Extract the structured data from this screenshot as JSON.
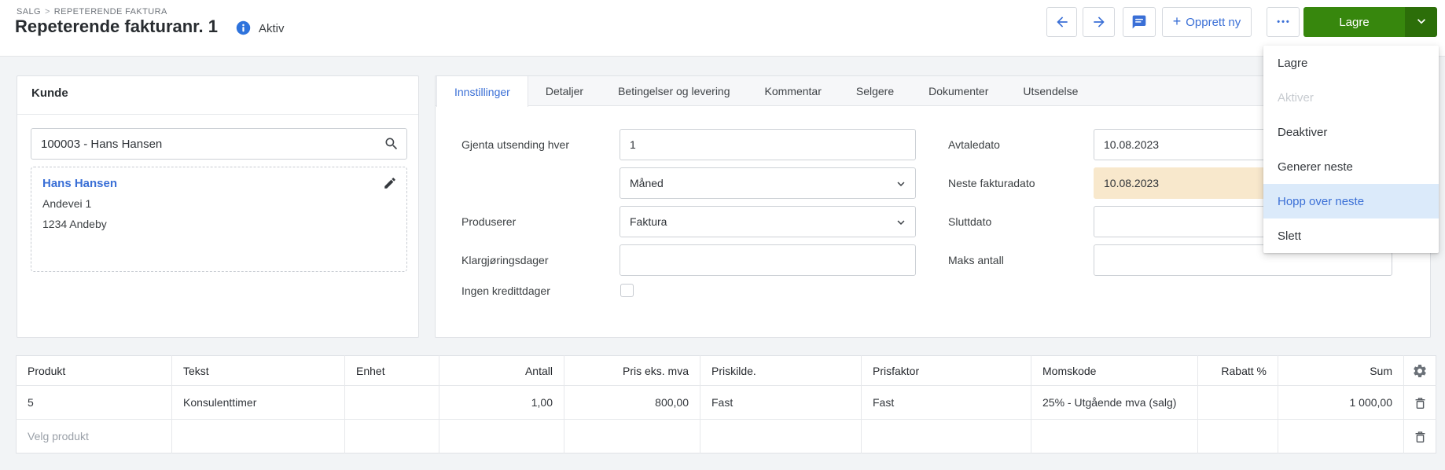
{
  "colors": {
    "accent_blue": "#3a6fd6",
    "save_green": "#37870d",
    "save_green_dark": "#2c6e09",
    "next_date_highlight_bg": "#f8e8cc",
    "menu_highlight_bg": "#dbeafa",
    "status_icon_blue": "#2e73dc"
  },
  "breadcrumb": {
    "items": [
      "SALG",
      "REPETERENDE FAKTURA"
    ],
    "separator": ">"
  },
  "header": {
    "title": "Repeterende fakturanr. 1",
    "status": "Aktiv"
  },
  "toolbar": {
    "back_icon": "arrow-left",
    "forward_icon": "arrow-right",
    "comment_icon": "chat-bubble",
    "opprett_plus": "+",
    "opprett_label": "Opprett ny",
    "dots": "•••",
    "lagre_label": "Lagre"
  },
  "menu": {
    "items": [
      {
        "label": "Lagre",
        "state": "normal"
      },
      {
        "label": "Aktiver",
        "state": "disabled"
      },
      {
        "label": "Deaktiver",
        "state": "normal"
      },
      {
        "label": "Generer neste",
        "state": "normal"
      },
      {
        "label": "Hopp over neste",
        "state": "highlighted"
      },
      {
        "label": "Slett",
        "state": "normal"
      }
    ]
  },
  "customer": {
    "panel_title": "Kunde",
    "search_value": "100003 - Hans Hansen",
    "name": "Hans Hansen",
    "address1": "Andevei 1",
    "address2": "1234 Andeby"
  },
  "tabs": [
    {
      "label": "Innstillinger",
      "active": true
    },
    {
      "label": "Detaljer",
      "active": false
    },
    {
      "label": "Betingelser og levering",
      "active": false
    },
    {
      "label": "Kommentar",
      "active": false
    },
    {
      "label": "Selgere",
      "active": false
    },
    {
      "label": "Dokumenter",
      "active": false
    },
    {
      "label": "Utsendelse",
      "active": false
    }
  ],
  "form": {
    "left": [
      {
        "label": "Gjenta utsending hver",
        "value": "1",
        "type": "text"
      },
      {
        "label": "",
        "value": "Måned",
        "type": "select"
      },
      {
        "label": "Produserer",
        "value": "Faktura",
        "type": "select"
      },
      {
        "label": "Klargjøringsdager",
        "value": "",
        "type": "text"
      },
      {
        "label": "Ingen kredittdager",
        "type": "checkbox",
        "checked": false
      }
    ],
    "right": [
      {
        "label": "Avtaledato",
        "value": "10.08.2023",
        "highlighted": false
      },
      {
        "label": "Neste fakturadato",
        "value": "10.08.2023",
        "highlighted": true
      },
      {
        "label": "Sluttdato",
        "value": "",
        "highlighted": false
      },
      {
        "label": "Maks antall",
        "value": "",
        "highlighted": false
      }
    ]
  },
  "table": {
    "columns": [
      "Produkt",
      "Tekst",
      "Enhet",
      "Antall",
      "Pris eks. mva",
      "Priskilde.",
      "Prisfaktor",
      "Momskode",
      "Rabatt %",
      "Sum"
    ],
    "rows": [
      {
        "produkt": "5",
        "tekst": "Konsulenttimer",
        "enhet": "",
        "antall": "1,00",
        "pris_eks_mva": "800,00",
        "priskilde": "Fast",
        "prisfaktor": "Fast",
        "momskode": "25% - Utgående mva (salg)",
        "rabatt": "",
        "sum": "1 000,00"
      },
      {
        "produkt": "Velg produkt",
        "tekst": "",
        "enhet": "",
        "antall": "",
        "pris_eks_mva": "",
        "priskilde": "",
        "prisfaktor": "",
        "momskode": "",
        "rabatt": "",
        "sum": ""
      }
    ]
  }
}
